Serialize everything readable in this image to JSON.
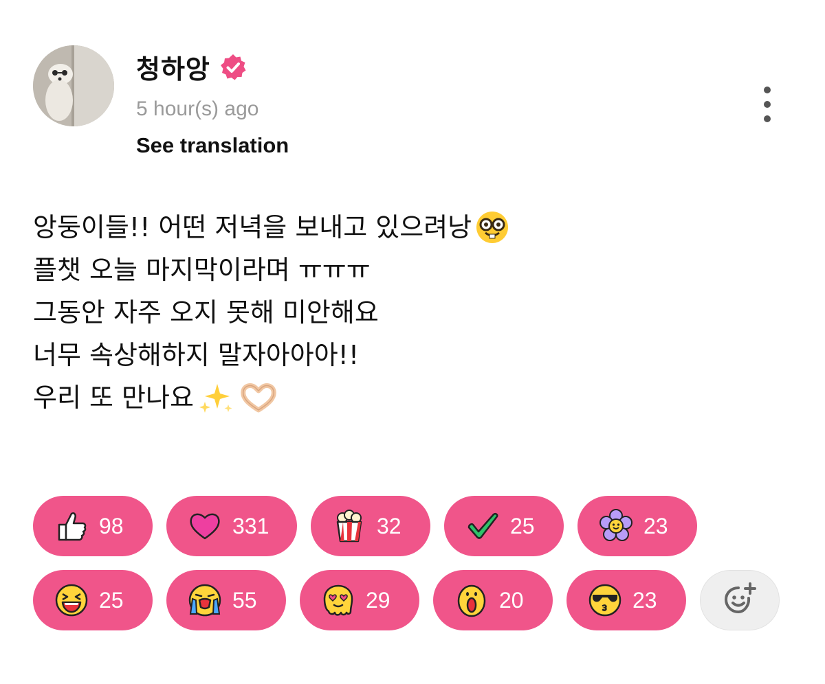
{
  "post": {
    "author_name": "청하앙",
    "timestamp": "5 hour(s) ago",
    "see_translation": "See translation",
    "lines": [
      "앙둥이들!! 어떤 저녁을 보내고 있으려낭",
      "플챗 오늘 마지막이라며 ㅠㅠㅠ",
      "그동안 자주 오지 못해 미안해요",
      "너무 속상해하지 말자아아아!!",
      "우리 또 만나요"
    ],
    "line_emojis": [
      "nerd-face-icon",
      "",
      "",
      "",
      "sparkles-icon, heart-hands-icon"
    ]
  },
  "reactions": [
    {
      "icon": "thumbs-up-icon",
      "count": "98"
    },
    {
      "icon": "heart-icon",
      "count": "331"
    },
    {
      "icon": "popcorn-icon",
      "count": "32"
    },
    {
      "icon": "check-mark-icon",
      "count": "25"
    },
    {
      "icon": "flower-icon",
      "count": "23"
    },
    {
      "icon": "laughing-face-icon",
      "count": "25"
    },
    {
      "icon": "crying-face-icon",
      "count": "55"
    },
    {
      "icon": "melting-heart-eyes-icon",
      "count": "29"
    },
    {
      "icon": "surprised-face-icon",
      "count": "20"
    },
    {
      "icon": "sunglasses-kiss-face-icon",
      "count": "23"
    }
  ],
  "colors": {
    "reaction_pill": "#f0558a",
    "verified_badge": "#ee4d84",
    "timestamp": "#9a9a9a",
    "add_reaction_bg": "#efefef"
  }
}
